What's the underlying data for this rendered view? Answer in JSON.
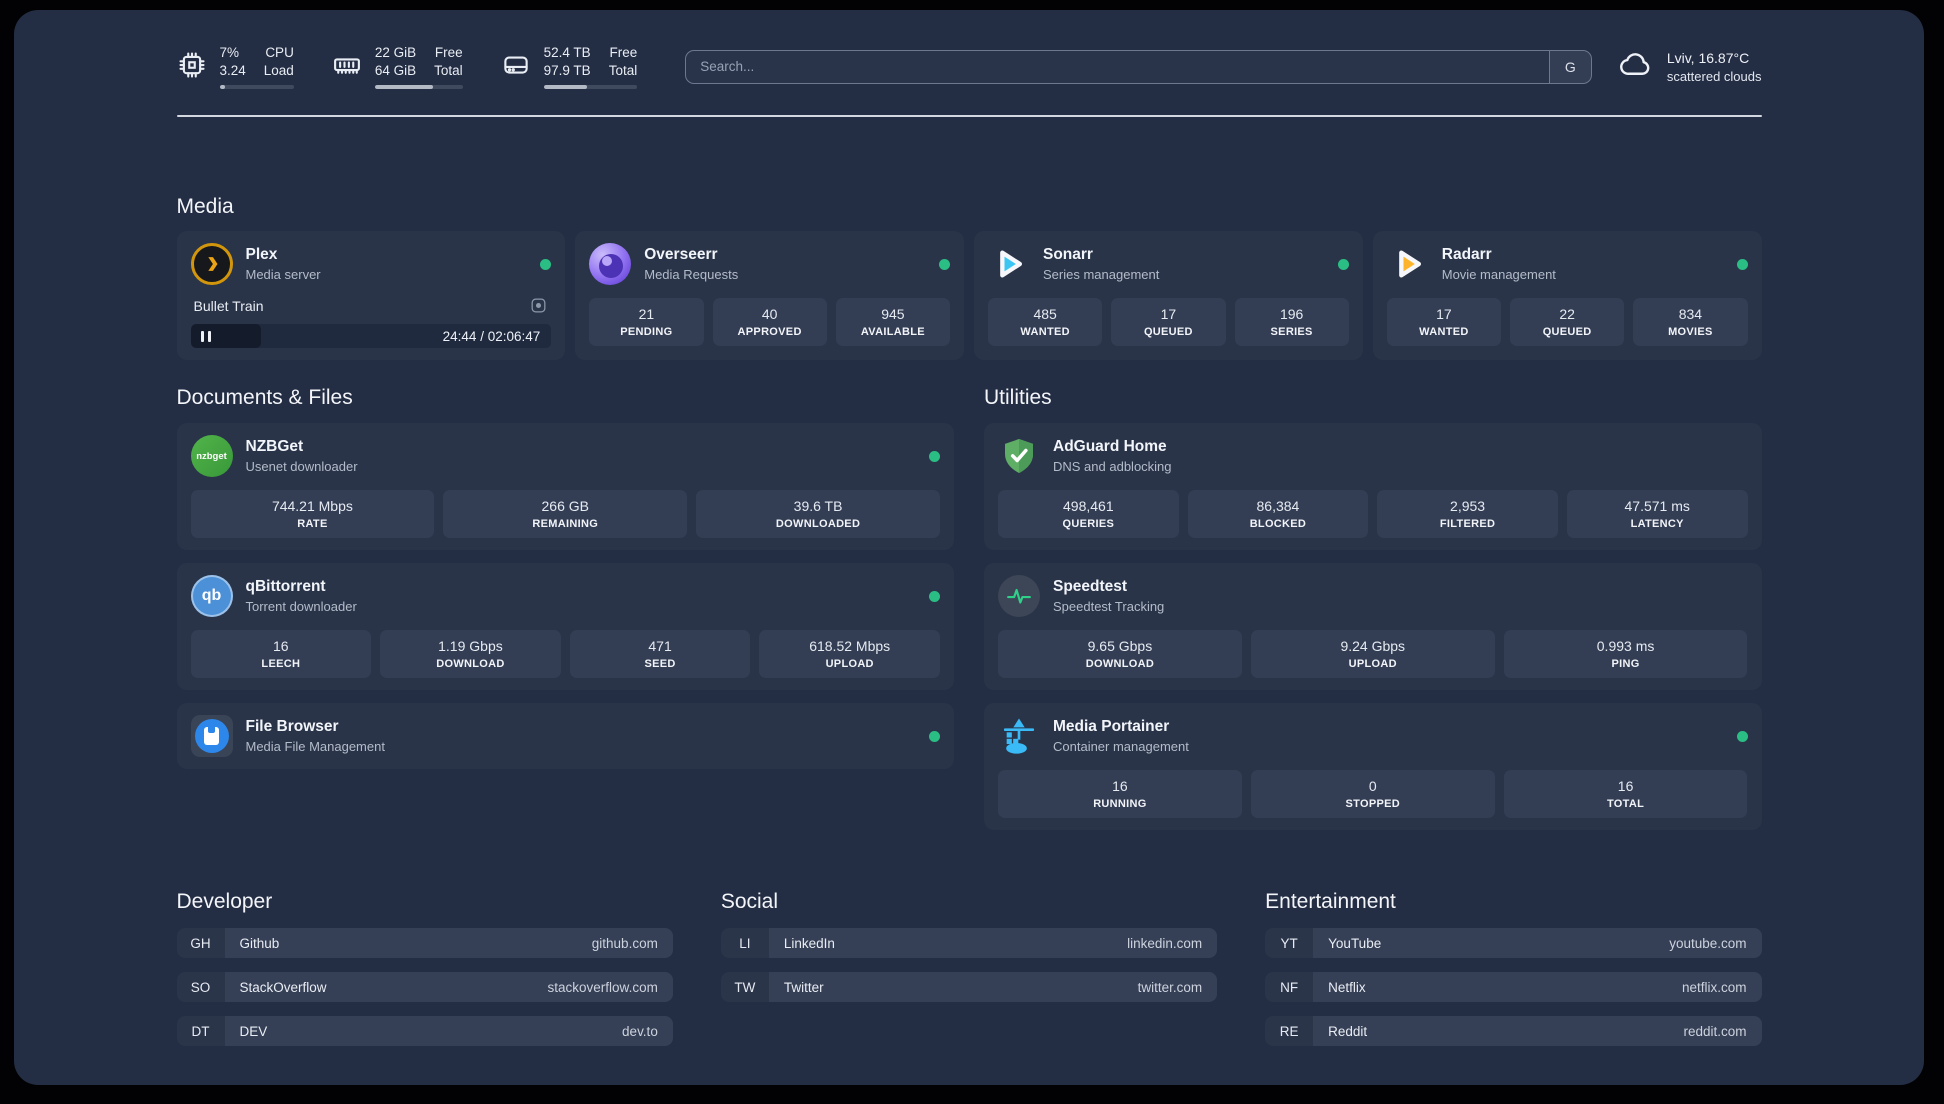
{
  "header": {
    "cpu": {
      "value_top": "7%",
      "value_bottom": "3.24",
      "label_top": "CPU",
      "label_bottom": "Load",
      "progress": 7
    },
    "memory": {
      "value_top": "22 GiB",
      "value_bottom": "64 GiB",
      "label_top": "Free",
      "label_bottom": "Total",
      "progress": 66
    },
    "disk": {
      "value_top": "52.4 TB",
      "value_bottom": "97.9 TB",
      "label_top": "Free",
      "label_bottom": "Total",
      "progress": 46
    },
    "search": {
      "placeholder": "Search...",
      "button": "G"
    },
    "weather": {
      "location": "Lviv, 16.87°C",
      "condition": "scattered clouds"
    }
  },
  "media": {
    "title": "Media",
    "plex": {
      "name": "Plex",
      "subtitle": "Media server",
      "status": "online",
      "now_playing": {
        "title": "Bullet Train",
        "time_display": "24:44 / 02:06:47",
        "state": "paused",
        "progress_percent": 19.5
      }
    },
    "overseerr": {
      "name": "Overseerr",
      "subtitle": "Media Requests",
      "status": "online",
      "stats": [
        {
          "value": "21",
          "label": "PENDING"
        },
        {
          "value": "40",
          "label": "APPROVED"
        },
        {
          "value": "945",
          "label": "AVAILABLE"
        }
      ]
    },
    "sonarr": {
      "name": "Sonarr",
      "subtitle": "Series management",
      "status": "online",
      "stats": [
        {
          "value": "485",
          "label": "WANTED"
        },
        {
          "value": "17",
          "label": "QUEUED"
        },
        {
          "value": "196",
          "label": "SERIES"
        }
      ]
    },
    "radarr": {
      "name": "Radarr",
      "subtitle": "Movie management",
      "status": "online",
      "stats": [
        {
          "value": "17",
          "label": "WANTED"
        },
        {
          "value": "22",
          "label": "QUEUED"
        },
        {
          "value": "834",
          "label": "MOVIES"
        }
      ]
    }
  },
  "documents": {
    "title": "Documents & Files",
    "nzbget": {
      "name": "NZBGet",
      "subtitle": "Usenet downloader",
      "status": "online",
      "icon_text": "nzbget",
      "stats": [
        {
          "value": "744.21 Mbps",
          "label": "RATE"
        },
        {
          "value": "266 GB",
          "label": "REMAINING"
        },
        {
          "value": "39.6 TB",
          "label": "DOWNLOADED"
        }
      ]
    },
    "qbittorrent": {
      "name": "qBittorrent",
      "subtitle": "Torrent downloader",
      "status": "online",
      "icon_text": "qb",
      "stats": [
        {
          "value": "16",
          "label": "LEECH"
        },
        {
          "value": "1.19 Gbps",
          "label": "DOWNLOAD"
        },
        {
          "value": "471",
          "label": "SEED"
        },
        {
          "value": "618.52 Mbps",
          "label": "UPLOAD"
        }
      ]
    },
    "filebrowser": {
      "name": "File Browser",
      "subtitle": "Media File Management",
      "status": "online"
    }
  },
  "utilities": {
    "title": "Utilities",
    "adguard": {
      "name": "AdGuard Home",
      "subtitle": "DNS and adblocking",
      "stats": [
        {
          "value": "498,461",
          "label": "QUERIES"
        },
        {
          "value": "86,384",
          "label": "BLOCKED"
        },
        {
          "value": "2,953",
          "label": "FILTERED"
        },
        {
          "value": "47.571 ms",
          "label": "LATENCY"
        }
      ]
    },
    "speedtest": {
      "name": "Speedtest",
      "subtitle": "Speedtest Tracking",
      "stats": [
        {
          "value": "9.65 Gbps",
          "label": "DOWNLOAD"
        },
        {
          "value": "9.24 Gbps",
          "label": "UPLOAD"
        },
        {
          "value": "0.993 ms",
          "label": "PING"
        }
      ]
    },
    "portainer": {
      "name": "Media Portainer",
      "subtitle": "Container management",
      "status": "online",
      "stats": [
        {
          "value": "16",
          "label": "RUNNING"
        },
        {
          "value": "0",
          "label": "STOPPED"
        },
        {
          "value": "16",
          "label": "TOTAL"
        }
      ]
    }
  },
  "links": {
    "developer": {
      "title": "Developer",
      "items": [
        {
          "abbr": "GH",
          "name": "Github",
          "url": "github.com"
        },
        {
          "abbr": "SO",
          "name": "StackOverflow",
          "url": "stackoverflow.com"
        },
        {
          "abbr": "DT",
          "name": "DEV",
          "url": "dev.to"
        }
      ]
    },
    "social": {
      "title": "Social",
      "items": [
        {
          "abbr": "LI",
          "name": "LinkedIn",
          "url": "linkedin.com"
        },
        {
          "abbr": "TW",
          "name": "Twitter",
          "url": "twitter.com"
        }
      ]
    },
    "entertainment": {
      "title": "Entertainment",
      "items": [
        {
          "abbr": "YT",
          "name": "YouTube",
          "url": "youtube.com"
        },
        {
          "abbr": "NF",
          "name": "Netflix",
          "url": "netflix.com"
        },
        {
          "abbr": "RE",
          "name": "Reddit",
          "url": "reddit.com"
        }
      ]
    }
  },
  "colors": {
    "panel": "#232d43",
    "card": "#2a3449",
    "stat_tile": "#333e55",
    "status_green": "#2abe85",
    "plex_amber": "#eda50e",
    "overseerr_purple": "#8b6cf0",
    "sonarr_cyan": "#3bc5f3",
    "radarr_amber": "#fdb32a",
    "nzbget_green": "#46a844",
    "qbittorrent_blue": "#4c90d8",
    "filebrowser_blue": "#2d87ea",
    "adguard_green": "#5fae66",
    "speedtest_green": "#2fd088",
    "portainer_blue": "#3abaf7"
  }
}
